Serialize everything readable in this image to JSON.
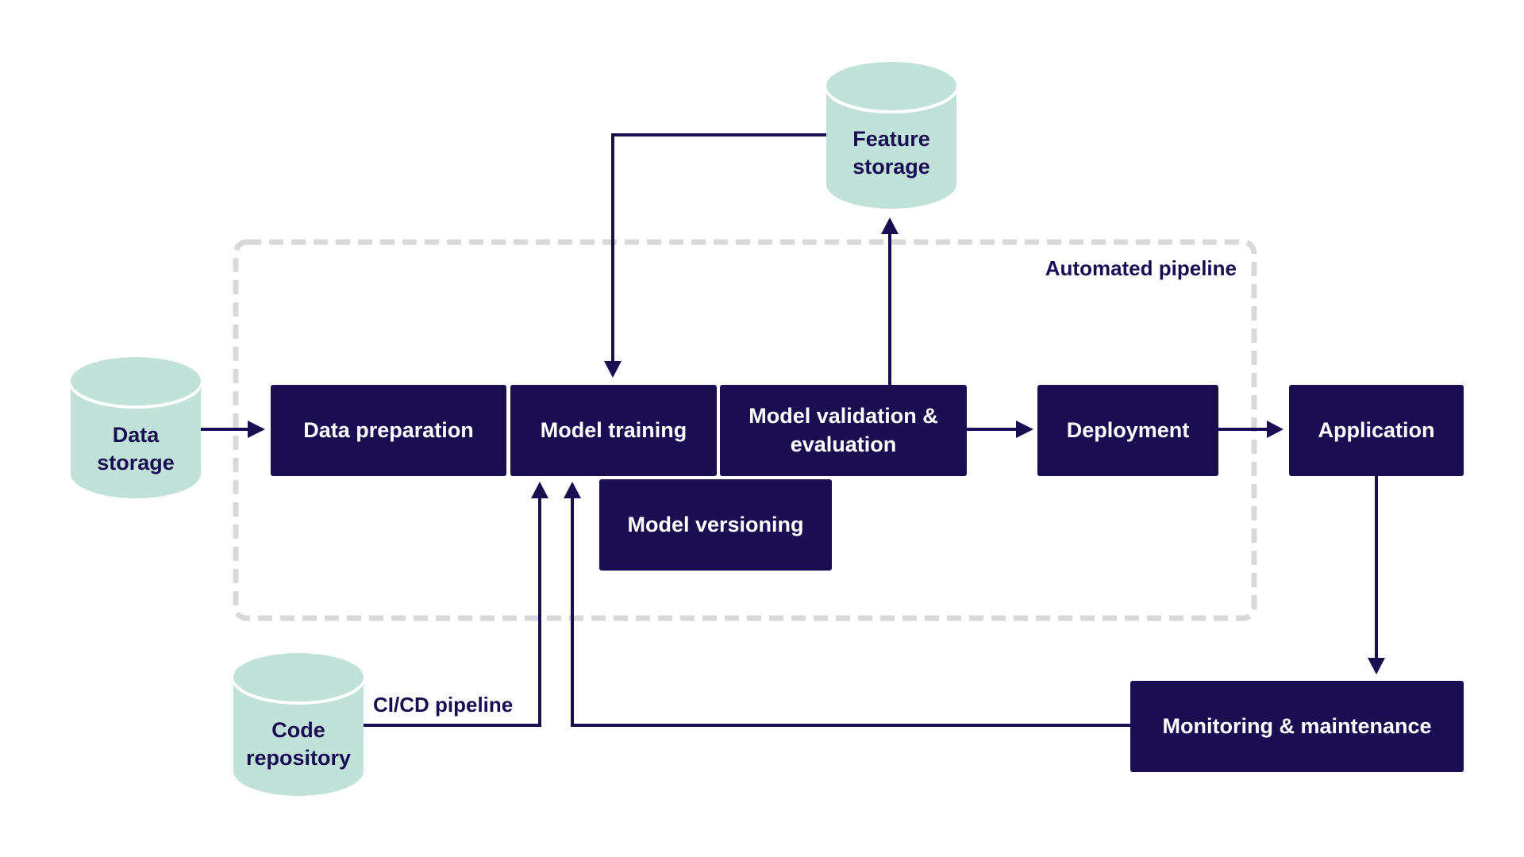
{
  "colors": {
    "box_fill": "#1b0d52",
    "box_text": "#ffffff",
    "storage_fill": "#c0e2d8",
    "storage_text": "#1b0d52",
    "connector": "#1b0d52",
    "pipeline_border": "#d9d9d9"
  },
  "pipeline_group": {
    "label": "Automated pipeline"
  },
  "storages": {
    "data_storage": {
      "line1": "Data",
      "line2": "storage"
    },
    "feature_storage": {
      "line1": "Feature",
      "line2": "storage"
    },
    "code_repository": {
      "line1": "Code",
      "line2": "repository"
    }
  },
  "steps": {
    "data_preparation": "Data preparation",
    "model_training": "Model training",
    "model_validation": "Model validation & evaluation",
    "model_versioning": "Model versioning",
    "deployment": "Deployment",
    "application": "Application",
    "monitoring": "Monitoring & maintenance"
  },
  "edge_labels": {
    "cicd": "CI/CD pipeline"
  },
  "edges": [
    {
      "from": "Data storage",
      "to": "Data preparation"
    },
    {
      "from": "Feature storage",
      "to": "Model training"
    },
    {
      "from": "Model validation & evaluation",
      "to": "Feature storage"
    },
    {
      "from": "Model validation & evaluation",
      "to": "Deployment"
    },
    {
      "from": "Deployment",
      "to": "Application"
    },
    {
      "from": "Application",
      "to": "Monitoring & maintenance"
    },
    {
      "from": "Code repository",
      "to": "Model training",
      "label": "CI/CD pipeline"
    },
    {
      "from": "Monitoring & maintenance",
      "to": "Model training"
    }
  ]
}
